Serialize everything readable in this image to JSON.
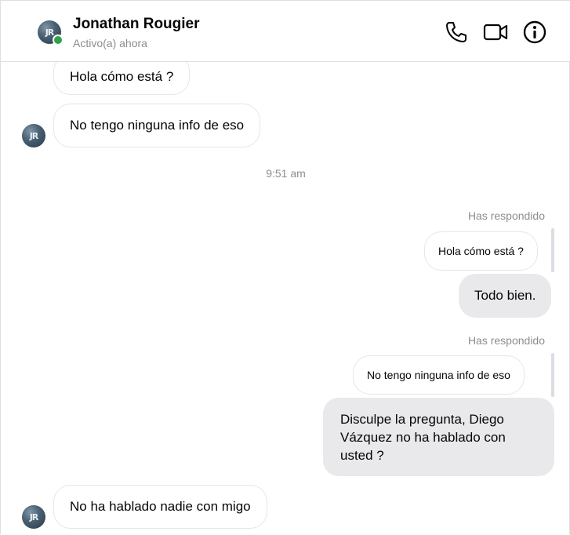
{
  "header": {
    "contact_name": "Jonathan Rougier",
    "status": "Activo(a) ahora",
    "avatar_initials": "JR",
    "icons": [
      "phone-icon",
      "video-camera-icon",
      "info-icon"
    ],
    "online_color": "#31a24c"
  },
  "messages": {
    "m1": "Hola cómo está ?",
    "m2": "No tengo ninguna info de eso",
    "timestamp": "9:51 am",
    "replied_label_1": "Has respondido",
    "quoted_1": "Hola cómo está ?",
    "reply_1": "Todo bien.",
    "replied_label_2": "Has respondido",
    "quoted_2": "No tengo ninguna info de eso",
    "reply_2": "Disculpe la pregunta, Diego Vázquez no ha hablado con usted ?",
    "m3": "No ha hablado nadie con migo"
  },
  "colors": {
    "outgoing_bubble": "#e9e9eb",
    "incoming_border": "#e4e6eb",
    "meta_text": "#8a8d91"
  }
}
